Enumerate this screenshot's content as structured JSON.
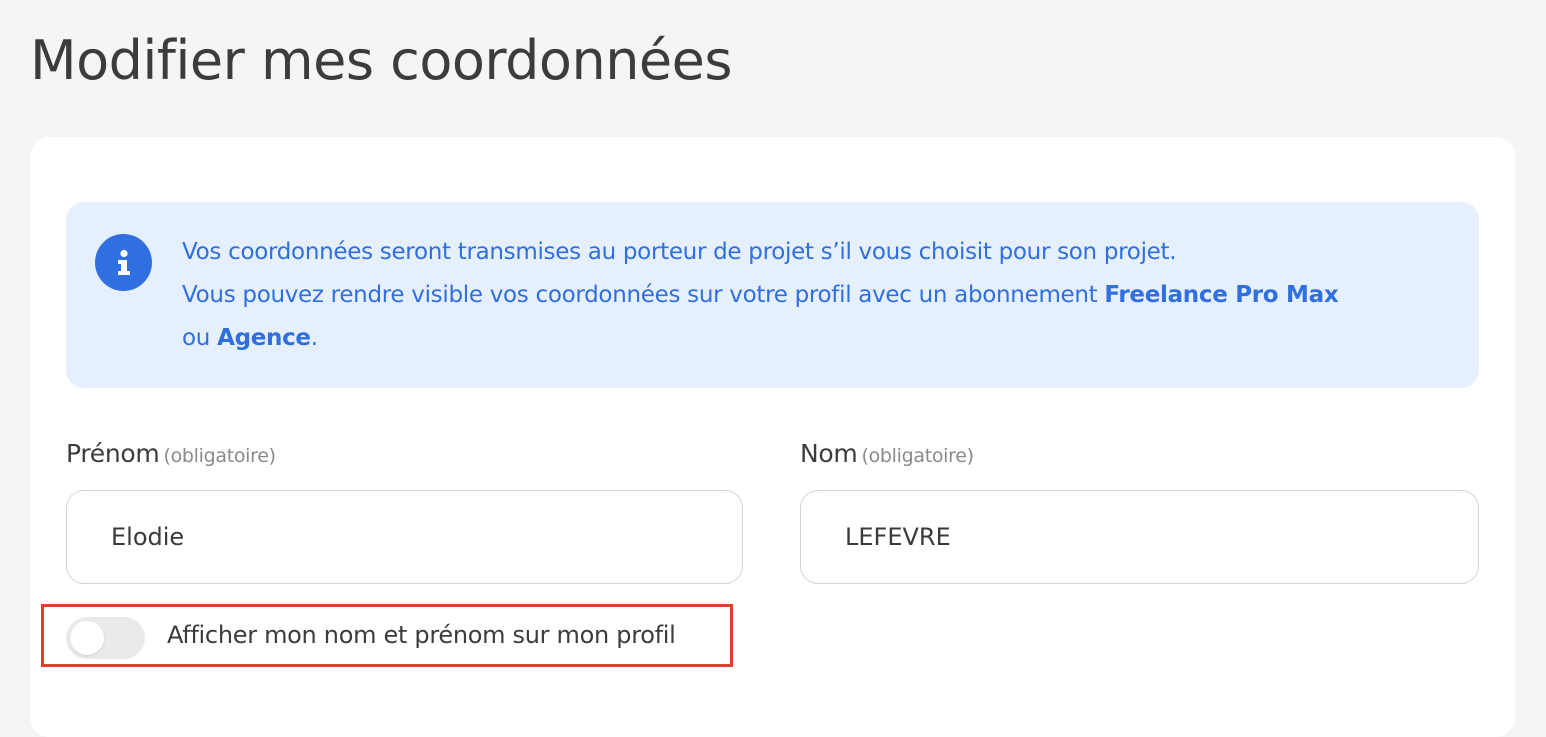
{
  "page": {
    "title": "Modifier mes coordonnées"
  },
  "info": {
    "icon": "info-icon",
    "line1": "Vos coordonnées seront transmises au porteur de projet s’il vous choisit pour son projet.",
    "line2_prefix": "Vous pouvez rendre visible vos coordonnées sur votre profil avec un abonnement ",
    "plan_pro": "Freelance Pro Max",
    "line3_prefix": "ou ",
    "plan_agency": "Agence",
    "line3_suffix": "."
  },
  "form": {
    "first_name": {
      "label": "Prénom",
      "hint": "(obligatoire)",
      "value": "Elodie"
    },
    "last_name": {
      "label": "Nom",
      "hint": "(obligatoire)",
      "value": "LEFEVRE"
    },
    "show_name_toggle": {
      "label": "Afficher mon nom et prénom sur mon profil",
      "checked": false
    }
  },
  "colors": {
    "accent": "#2f6fe0",
    "info_background": "#e6effc",
    "highlight": "#e0412f",
    "page_background": "#f4f5f7"
  }
}
